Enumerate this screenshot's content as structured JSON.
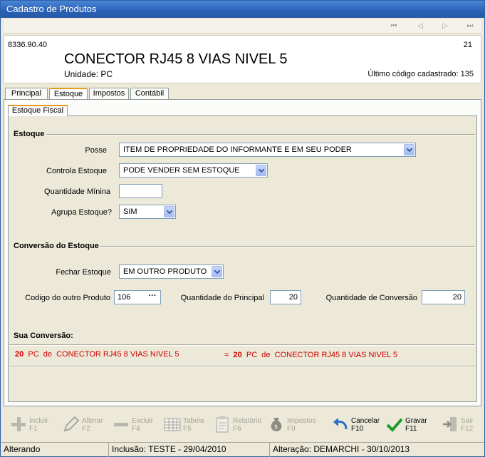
{
  "window": {
    "title": "Cadastro de Produtos"
  },
  "header": {
    "code": "8336.90.40",
    "record_number": "21",
    "product_name": "CONECTOR RJ45 8 VIAS NIVEL 5",
    "unit_label": "Unidade:",
    "unit_value": "PC",
    "last_code_text": "Último código cadastrado: 135"
  },
  "tabs": [
    "Principal",
    "Estoque",
    "Impostos",
    "Contábil"
  ],
  "active_tab": "Estoque",
  "subtab": "Estoque Fiscal",
  "estoque": {
    "section_title": "Estoque",
    "posse_label": "Posse",
    "posse_value": "ITEM DE PROPRIEDADE DO INFORMANTE E EM SEU PODER",
    "controla_label": "Controla Estoque",
    "controla_value": "PODE VENDER SEM ESTOQUE",
    "qtd_min_label": "Quantidade Mínina",
    "qtd_min_value": "",
    "agrupa_label": "Agrupa Estoque?",
    "agrupa_value": "SIM"
  },
  "conversao": {
    "section_title": "Conversão do Estoque",
    "fechar_label": "Fechar Estoque",
    "fechar_value": "EM OUTRO PRODUTO",
    "codigo_label": "Codigo do outro Produto",
    "codigo_value": "106",
    "lookup_label": "···",
    "qtd_principal_label": "Quantidade do Principal",
    "qtd_principal_value": "20",
    "qtd_conversao_label": "Quantidade de Conversão",
    "qtd_conversao_value": "20"
  },
  "sua_conversao": {
    "title": "Sua Conversão:",
    "left_qty": "20",
    "left_text": "  PC  de  CONECTOR RJ45 8 VIAS NIVEL 5",
    "right_prefix": "=  ",
    "right_qty": "20",
    "right_text": "  PC  de  CONECTOR RJ45 8 VIAS NIVEL 5"
  },
  "toolbar": {
    "incluir": {
      "label": "Incluir",
      "key": "F1"
    },
    "alterar": {
      "label": "Alterar",
      "key": "F2"
    },
    "excluir": {
      "label": "Excluir",
      "key": "F4"
    },
    "tabela": {
      "label": "Tabela",
      "key": "F5"
    },
    "relatorio": {
      "label": "Relatório",
      "key": "F6"
    },
    "impostos": {
      "label": "Impostos",
      "key": "F9"
    },
    "cancelar": {
      "label": "Cancelar",
      "key": "F10"
    },
    "gravar": {
      "label": "Gravar",
      "key": "F11"
    },
    "sair": {
      "label": "Sair",
      "key": "F12"
    }
  },
  "status": {
    "mode": "Alterando",
    "inclusao": "Inclusão: TESTE - 29/04/2010",
    "alteracao": "Alteração: DEMARCHI - 30/10/2013"
  },
  "colors": {
    "accent": "#e69a1e",
    "title_bar": "#2a62b8",
    "conversion_text": "#d00000"
  }
}
